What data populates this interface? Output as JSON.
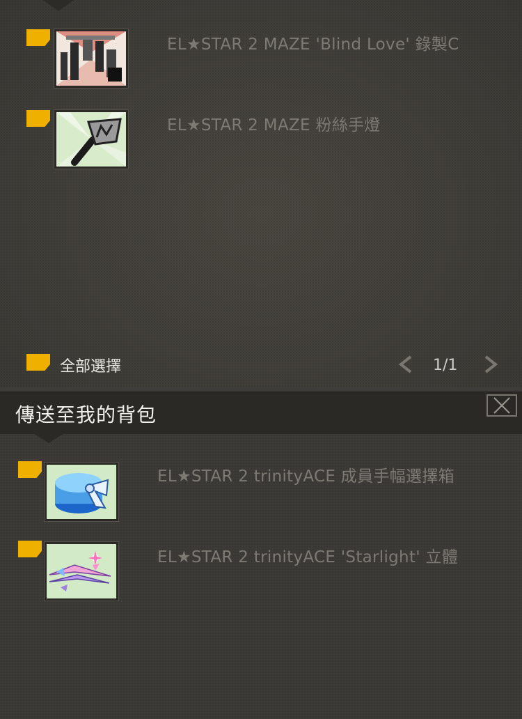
{
  "top_list": {
    "items": [
      {
        "name": "EL★STAR 2 MAZE 'Blind Love' 錄製C",
        "icon": "recording-stage-icon"
      },
      {
        "name": "EL★STAR 2 MAZE 粉絲手燈",
        "icon": "fan-lightstick-icon"
      }
    ]
  },
  "footer": {
    "select_all_label": "全部選擇",
    "page_indicator": "1/1"
  },
  "send_section": {
    "title": "傳送至我的背包"
  },
  "bottom_list": {
    "items": [
      {
        "name": "EL★STAR 2 trinityACE 成員手幅選擇箱",
        "icon": "gift-box-icon"
      },
      {
        "name": "EL★STAR 2 trinityACE 'Starlight' 立體",
        "icon": "starlight-ribbon-icon"
      }
    ]
  },
  "colors": {
    "checkbox": "#f0b000",
    "panel_bg": "#3f3d39",
    "header_bg": "#2a2926",
    "item_text": "#7d7a74"
  }
}
